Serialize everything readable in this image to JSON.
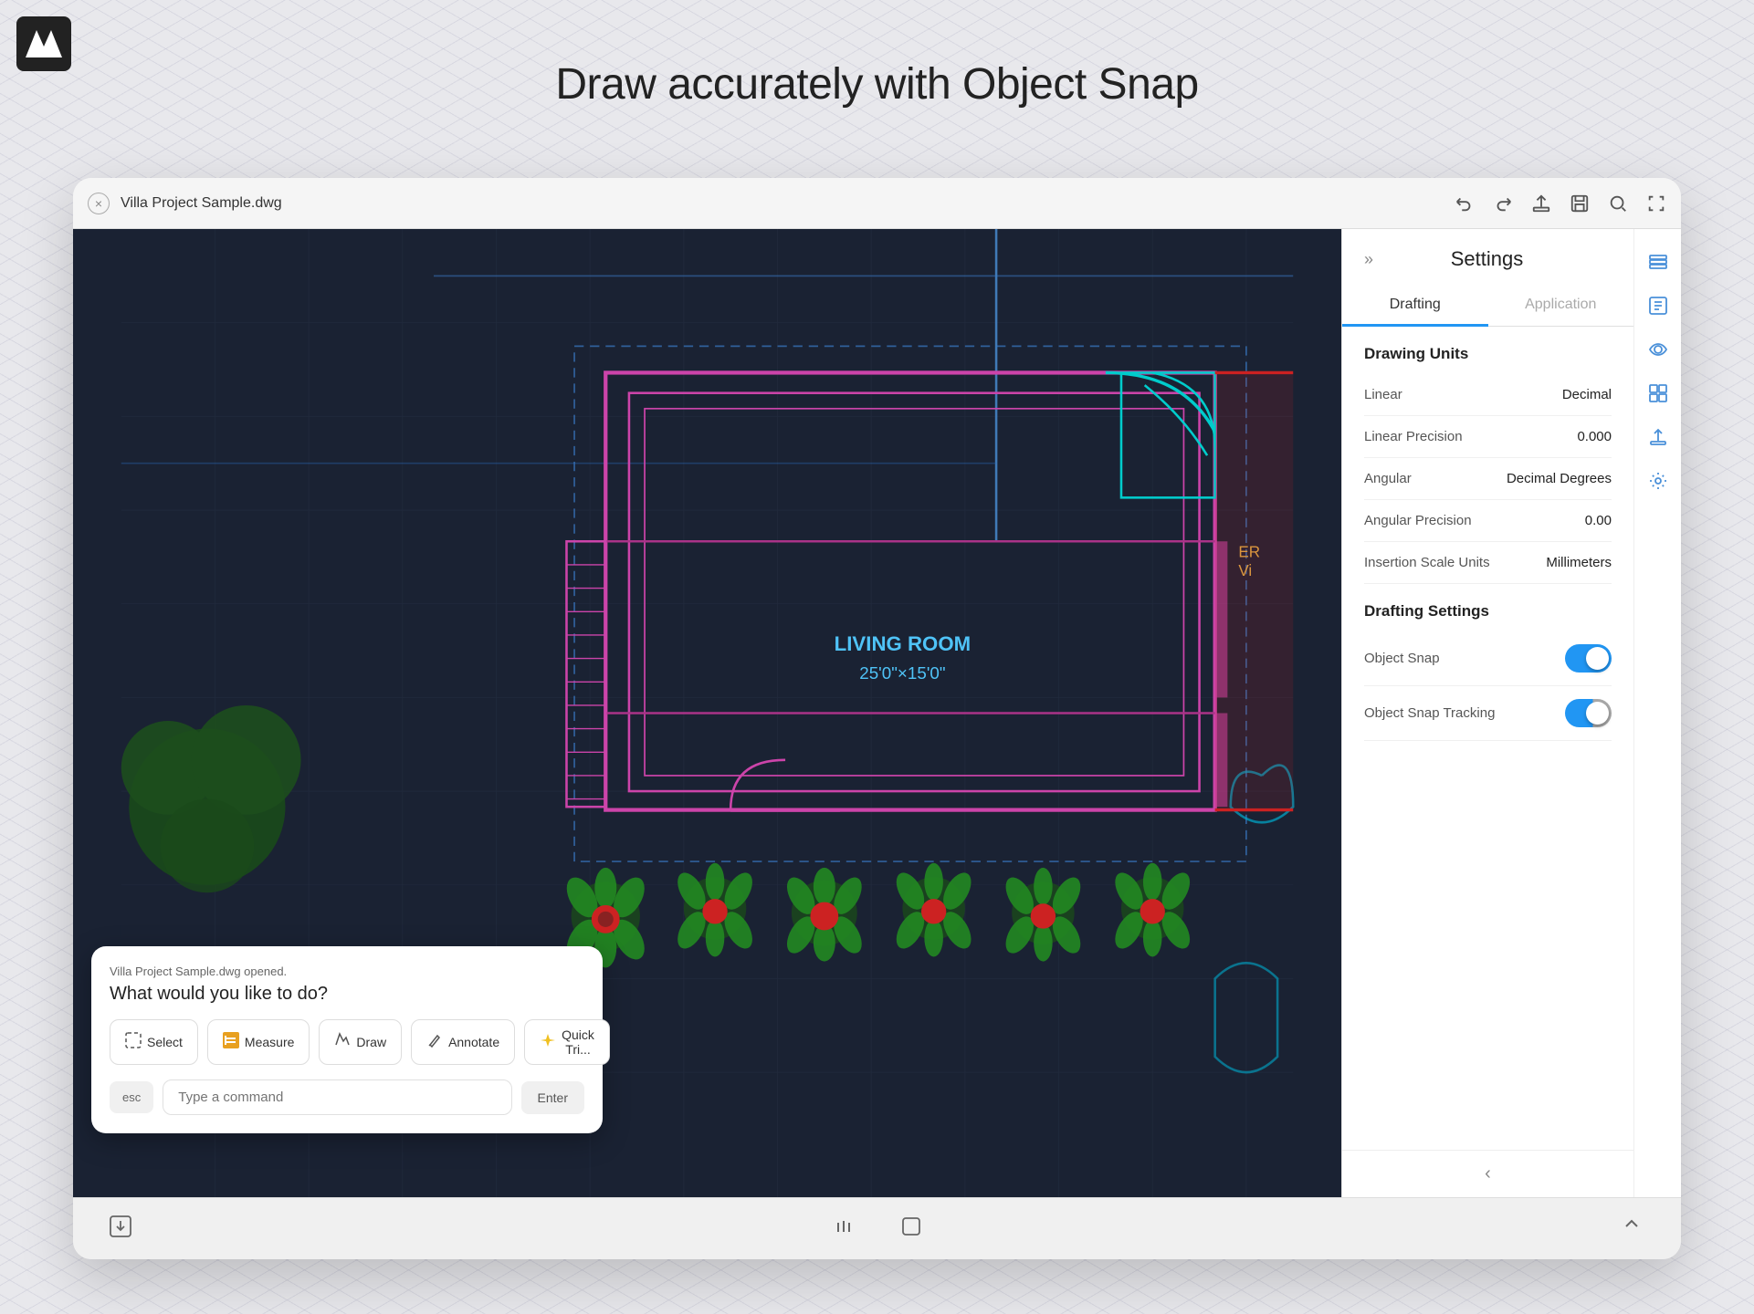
{
  "page": {
    "title": "Draw accurately with Object Snap",
    "bg_pattern": true
  },
  "logo": {
    "alt": "App logo"
  },
  "window": {
    "title": "Villa Project Sample.dwg",
    "close_label": "×",
    "toolbar_buttons": [
      "undo",
      "redo",
      "upload",
      "save",
      "search",
      "fullscreen"
    ]
  },
  "drawing": {
    "room_label": "LIVING ROOM",
    "room_size": "25'0\"×15'0\""
  },
  "command_prompt": {
    "file_text": "Villa Project Sample.dwg opened.",
    "question": "What would you like to do?",
    "buttons": [
      {
        "id": "select",
        "label": "Select",
        "icon": "⬚"
      },
      {
        "id": "measure",
        "label": "Measure",
        "icon": "▦"
      },
      {
        "id": "draw",
        "label": "Draw",
        "icon": "✏"
      },
      {
        "id": "annotate",
        "label": "Annotate",
        "icon": "✒"
      },
      {
        "id": "quick-trim",
        "label": "Quick Tri...",
        "icon": "⚡"
      }
    ],
    "esc_label": "esc",
    "input_placeholder": "Type a command",
    "enter_label": "Enter"
  },
  "bottom_toolbar": {
    "left_icon": "⊡",
    "center_icons": [
      "|||",
      "○"
    ],
    "right_icon": "‹"
  },
  "settings": {
    "title": "Settings",
    "chevron": "»",
    "tabs": [
      {
        "id": "drafting",
        "label": "Drafting",
        "active": true
      },
      {
        "id": "application",
        "label": "Application",
        "active": false
      }
    ],
    "drawing_units_title": "Drawing Units",
    "rows": [
      {
        "id": "linear",
        "label": "Linear",
        "value": "Decimal"
      },
      {
        "id": "linear-precision",
        "label": "Linear Precision",
        "value": "0.000"
      },
      {
        "id": "angular",
        "label": "Angular",
        "value": "Decimal Degrees"
      },
      {
        "id": "angular-precision",
        "label": "Angular Precision",
        "value": "0.00"
      },
      {
        "id": "insertion-scale",
        "label": "Insertion Scale Units",
        "value": "Millimeters"
      }
    ],
    "drafting_settings_title": "Drafting Settings",
    "toggles": [
      {
        "id": "object-snap",
        "label": "Object Snap",
        "on": true
      },
      {
        "id": "object-snap-tracking",
        "label": "Object Snap Tracking",
        "on": true
      }
    ],
    "back_icon": "‹"
  },
  "side_icons": [
    {
      "id": "layers",
      "symbol": "☰",
      "title": "Layers"
    },
    {
      "id": "properties",
      "symbol": "⊡",
      "title": "Properties"
    },
    {
      "id": "view",
      "symbol": "👁",
      "title": "View"
    },
    {
      "id": "blocks",
      "symbol": "⬚",
      "title": "Blocks"
    },
    {
      "id": "export",
      "symbol": "⬆",
      "title": "Export"
    },
    {
      "id": "settings-gear",
      "symbol": "⚙",
      "title": "Settings"
    }
  ]
}
